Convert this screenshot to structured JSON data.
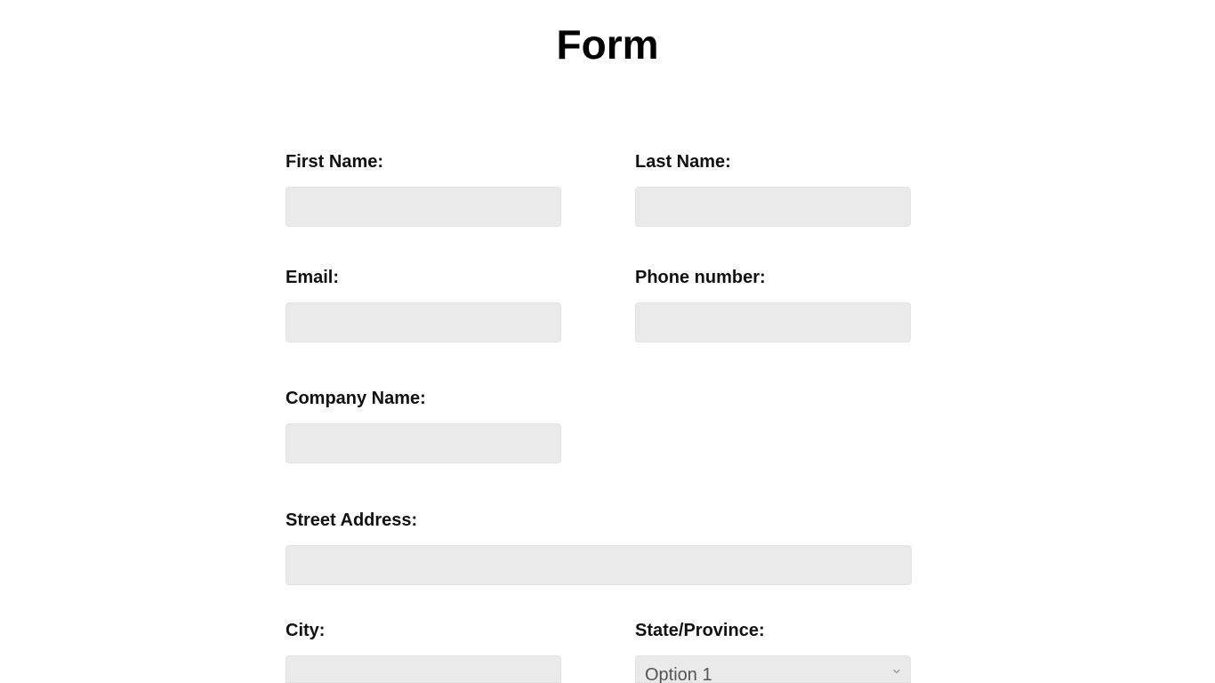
{
  "page": {
    "title": "Form"
  },
  "fields": {
    "first_name": {
      "label": "First Name:",
      "value": ""
    },
    "last_name": {
      "label": "Last Name:",
      "value": ""
    },
    "email": {
      "label": "Email:",
      "value": ""
    },
    "phone": {
      "label": "Phone number:",
      "value": ""
    },
    "company": {
      "label": "Company Name:",
      "value": ""
    },
    "street": {
      "label": "Street Address:",
      "value": ""
    },
    "city": {
      "label": "City:",
      "value": ""
    },
    "state": {
      "label": "State/Province:",
      "selected": "Option 1",
      "icon": "chevron-down-icon"
    }
  },
  "colors": {
    "input_background": "#eaeaea",
    "text": "#111111",
    "placeholder_text": "#555555"
  }
}
